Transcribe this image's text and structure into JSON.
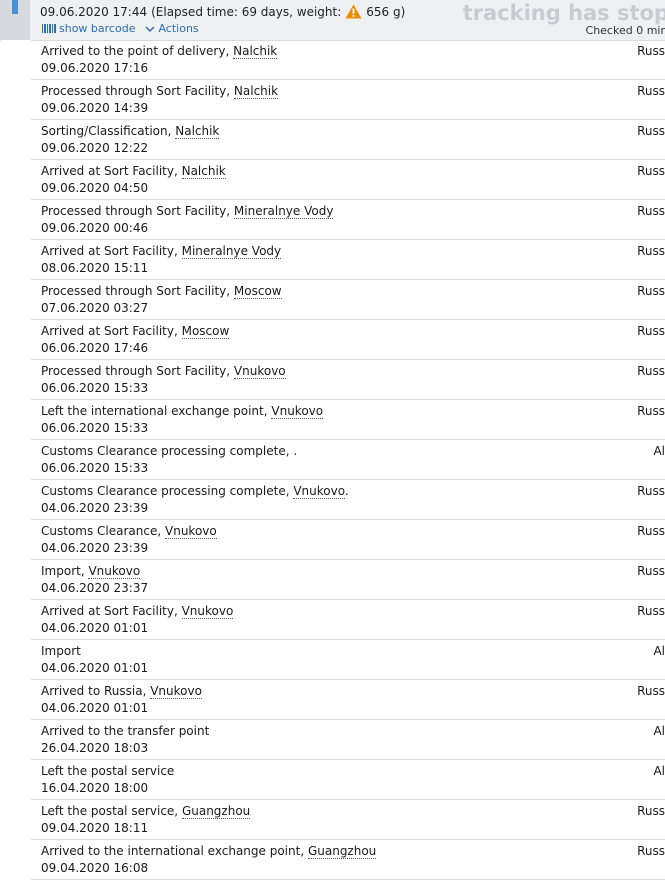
{
  "header": {
    "summary_date": "09.06.2020 17:44",
    "summary_details": "(Elapsed time: 69 days, weight:",
    "summary_weight": "656 g)",
    "watermark": "tracking has stop",
    "show_barcode": "show barcode",
    "actions": "Actions",
    "checked": "Checked 0 mir"
  },
  "events": [
    {
      "event": "Arrived to the point of delivery, ",
      "location": "Nalchik",
      "after": "",
      "date": "09.06.2020 17:16",
      "country": "Russ"
    },
    {
      "event": "Processed through Sort Facility, ",
      "location": "Nalchik",
      "after": "",
      "date": "09.06.2020 14:39",
      "country": "Russ"
    },
    {
      "event": "Sorting/Classification, ",
      "location": "Nalchik",
      "after": "",
      "date": "09.06.2020 12:22",
      "country": "Russ"
    },
    {
      "event": "Arrived at Sort Facility, ",
      "location": "Nalchik",
      "after": "",
      "date": "09.06.2020 04:50",
      "country": "Russ"
    },
    {
      "event": "Processed through Sort Facility, ",
      "location": "Mineralnye Vody",
      "after": "",
      "date": "09.06.2020 00:46",
      "country": "Russ"
    },
    {
      "event": "Arrived at Sort Facility, ",
      "location": "Mineralnye Vody",
      "after": "",
      "date": "08.06.2020 15:11",
      "country": "Russ"
    },
    {
      "event": "Processed through Sort Facility, ",
      "location": "Moscow",
      "after": "",
      "date": "07.06.2020 03:27",
      "country": "Russ"
    },
    {
      "event": "Arrived at Sort Facility, ",
      "location": "Moscow",
      "after": "",
      "date": "06.06.2020 17:46",
      "country": "Russ"
    },
    {
      "event": "Processed through Sort Facility, ",
      "location": "Vnukovo",
      "after": "",
      "date": "06.06.2020 15:33",
      "country": "Russ"
    },
    {
      "event": "Left the international exchange point, ",
      "location": "Vnukovo",
      "after": "",
      "date": "06.06.2020 15:33",
      "country": "Russ"
    },
    {
      "event": "Customs Clearance processing complete, .",
      "location": "",
      "after": "",
      "date": "06.06.2020 15:33",
      "country": "Al"
    },
    {
      "event": "Customs Clearance processing complete, ",
      "location": "Vnukovo",
      "after": ".",
      "date": "04.06.2020 23:39",
      "country": "Russ"
    },
    {
      "event": "Customs Clearance, ",
      "location": "Vnukovo",
      "after": "",
      "date": "04.06.2020 23:39",
      "country": "Russ"
    },
    {
      "event": "Import, ",
      "location": "Vnukovo",
      "after": "",
      "date": "04.06.2020 23:37",
      "country": "Russ"
    },
    {
      "event": "Arrived at Sort Facility, ",
      "location": "Vnukovo",
      "after": "",
      "date": "04.06.2020 01:01",
      "country": "Russ"
    },
    {
      "event": "Import",
      "location": "",
      "after": "",
      "date": "04.06.2020 01:01",
      "country": "Al"
    },
    {
      "event": "Arrived to Russia, ",
      "location": "Vnukovo",
      "after": "",
      "date": "04.06.2020 01:01",
      "country": "Russ"
    },
    {
      "event": "Arrived to the transfer point",
      "location": "",
      "after": "",
      "date": "26.04.2020 18:03",
      "country": "Al"
    },
    {
      "event": "Left the postal service",
      "location": "",
      "after": "",
      "date": "16.04.2020 18:00",
      "country": "Al"
    },
    {
      "event": "Left the postal service, ",
      "location": "Guangzhou",
      "after": "",
      "date": "09.04.2020 18:11",
      "country": "Russ"
    },
    {
      "event": "Arrived to the international exchange point, ",
      "location": "Guangzhou",
      "after": "",
      "date": "09.04.2020 16:08",
      "country": "Russ"
    }
  ],
  "colors": {
    "accent": "#2a6fb0",
    "warning": "#f08c00",
    "header_bg": "#eef0f2"
  }
}
